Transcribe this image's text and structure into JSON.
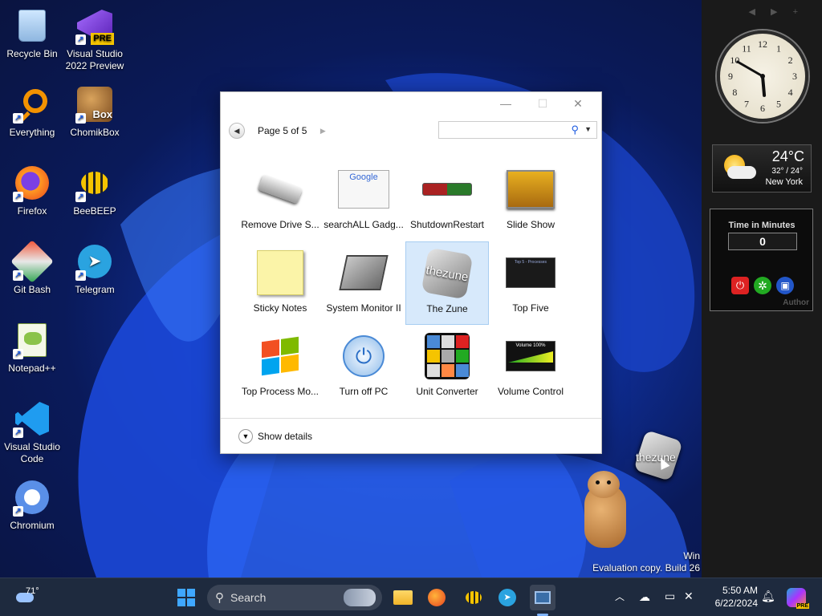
{
  "desktop": {
    "icons": [
      {
        "label": "Recycle Bin",
        "icon": "recycle-bin-icon"
      },
      {
        "label": "Visual Studio 2022 Preview",
        "icon": "visual-studio-preview-icon"
      },
      {
        "label": "Everything",
        "icon": "everything-search-icon"
      },
      {
        "label": "ChomikBox",
        "icon": "chomikbox-icon"
      },
      {
        "label": "Firefox",
        "icon": "firefox-icon"
      },
      {
        "label": "BeeBEEP",
        "icon": "beebeep-icon"
      },
      {
        "label": "Git Bash",
        "icon": "git-bash-icon"
      },
      {
        "label": "Telegram",
        "icon": "telegram-icon"
      },
      {
        "label": "Notepad++",
        "icon": "notepadpp-icon"
      },
      {
        "label": "Visual Studio Code",
        "icon": "vscode-icon"
      },
      {
        "label": "Chromium",
        "icon": "chromium-icon"
      }
    ],
    "vs_badge": "PRE",
    "box_badge": "Box",
    "dragging_gadget_label": "thezune",
    "watermark_line1": "Win",
    "watermark_line2": "Evaluation copy. Build 26"
  },
  "sidebar": {
    "clock": {
      "numbers": [
        "12",
        "1",
        "2",
        "3",
        "4",
        "5",
        "6",
        "7",
        "8",
        "9",
        "10",
        "11"
      ],
      "hour": 5,
      "minute": 50
    },
    "weather": {
      "temp": "24°C",
      "range": "32° / 24°",
      "city": "New York"
    },
    "timer": {
      "title": "Time in Minutes",
      "value": "0",
      "footer": "Author"
    }
  },
  "gadget_window": {
    "page_label": "Page 5 of 5",
    "search_placeholder": "",
    "show_details": "Show details",
    "items": [
      {
        "label": "Remove Drive S...",
        "icon": "usb-drive-icon",
        "selected": false
      },
      {
        "label": "searchALL Gadg...",
        "icon": "google-search-icon",
        "selected": false
      },
      {
        "label": "ShutdownRestart",
        "icon": "shutdown-restart-icon",
        "selected": false
      },
      {
        "label": "Slide Show",
        "icon": "slide-show-icon",
        "selected": false
      },
      {
        "label": "Sticky Notes",
        "icon": "sticky-notes-icon",
        "selected": false
      },
      {
        "label": "System Monitor II",
        "icon": "cpu-chip-icon",
        "selected": false
      },
      {
        "label": "The Zune",
        "icon": "zune-icon",
        "selected": true
      },
      {
        "label": "Top Five",
        "icon": "top-five-icon",
        "selected": false
      },
      {
        "label": "Top Process Mo...",
        "icon": "windows-tools-icon",
        "selected": false
      },
      {
        "label": "Turn off PC",
        "icon": "power-button-icon",
        "selected": false
      },
      {
        "label": "Unit Converter",
        "icon": "unit-converter-icon",
        "selected": false
      },
      {
        "label": "Volume Control",
        "icon": "volume-control-icon",
        "selected": false
      }
    ],
    "google_text": "Google",
    "zune_text": "thezune",
    "volume_text": "Volume 100%",
    "topfive_text": "Top 5 - Processes"
  },
  "taskbar": {
    "weather_temp": "71°",
    "search_label": "Search",
    "time": "5:50 AM",
    "date": "6/22/2024",
    "copilot_badge": "PRE"
  },
  "colors": {
    "accent": "#1d5be0",
    "selected_bg": "#d7e9fb",
    "taskbar": "#1e2a3e"
  }
}
